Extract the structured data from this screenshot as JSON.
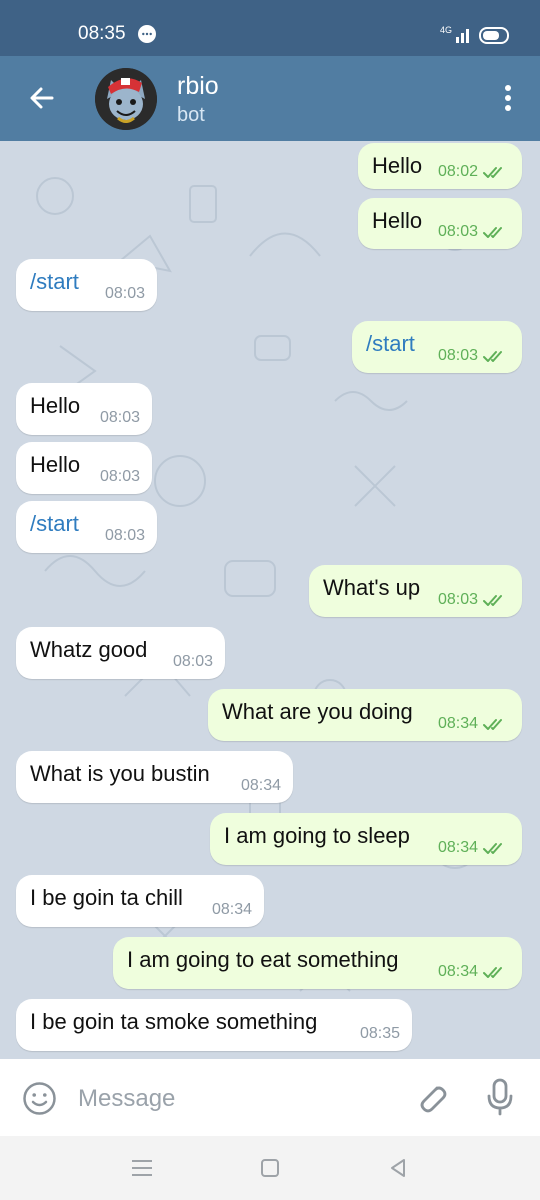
{
  "status_bar": {
    "time": "08:35",
    "network": "4G"
  },
  "header": {
    "title": "rbio",
    "subtitle": "bot"
  },
  "messages": [
    {
      "dir": "out",
      "text": "Hello",
      "time": "08:02"
    },
    {
      "dir": "out",
      "text": "Hello",
      "time": "08:03"
    },
    {
      "dir": "in",
      "text": "/start",
      "time": "08:03"
    },
    {
      "dir": "out",
      "text": "/start",
      "time": "08:03"
    },
    {
      "dir": "in",
      "text": "Hello",
      "time": "08:03"
    },
    {
      "dir": "in",
      "text": "Hello",
      "time": "08:03"
    },
    {
      "dir": "in",
      "text": "/start",
      "time": "08:03"
    },
    {
      "dir": "out",
      "text": "What's up",
      "time": "08:03"
    },
    {
      "dir": "in",
      "text": "Whatz good",
      "time": "08:03"
    },
    {
      "dir": "out",
      "text": "What are you doing",
      "time": "08:34"
    },
    {
      "dir": "in",
      "text": "What is you bustin",
      "time": "08:34"
    },
    {
      "dir": "out",
      "text": "I am going to sleep",
      "time": "08:34"
    },
    {
      "dir": "in",
      "text": "I be goin ta chill",
      "time": "08:34"
    },
    {
      "dir": "out",
      "text": "I am going to eat something",
      "time": "08:34"
    },
    {
      "dir": "in",
      "text": "I be goin ta smoke something",
      "time": "08:35"
    }
  ],
  "input": {
    "placeholder": "Message",
    "value": ""
  },
  "colors": {
    "header": "#517da2",
    "status_bar": "#3f6286",
    "incoming_bubble": "#ffffff",
    "outgoing_bubble": "#effedd",
    "command_text": "#2f7cbf",
    "read_ticks": "#5fb058"
  },
  "icons": {
    "back": "arrow-left-icon",
    "menu": "more-vertical-icon",
    "emoji": "smile-icon",
    "attach": "paperclip-icon",
    "mic": "microphone-icon",
    "read": "double-check-icon"
  }
}
